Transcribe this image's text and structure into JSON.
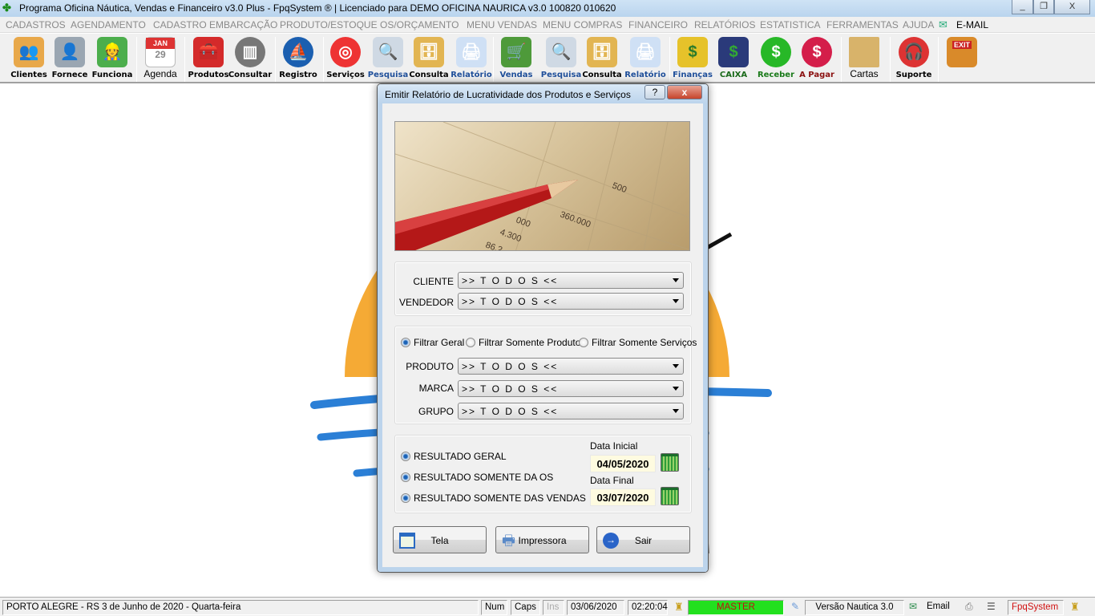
{
  "window": {
    "title": "Programa Oficina Náutica, Vendas e Financeiro v3.0 Plus - FpqSystem ® | Licenciado para  DEMO OFICINA NAURICA v3.0 100820 010620",
    "minimize": "_",
    "restore": "❐",
    "close": "X"
  },
  "menu": [
    "CADASTROS",
    "AGENDAMENTO",
    "CADASTRO EMBARCAÇÃO",
    "PRODUTO/ESTOQUE",
    "OS/ORÇAMENTO",
    "MENU VENDAS",
    "MENU COMPRAS",
    "FINANCEIRO",
    "RELATÓRIOS",
    "ESTATISTICA",
    "FERRAMENTAS",
    "AJUDA",
    "E-MAIL"
  ],
  "toolbar": [
    "Clientes",
    "Fornece",
    "Funciona",
    "Agenda",
    "Produtos",
    "Consultar",
    "Registro",
    "Serviços",
    "Pesquisa",
    "Consulta",
    "Relatório",
    "Vendas",
    "Pesquisa",
    "Consulta",
    "Relatório",
    "Finanças",
    "CAIXA",
    "Receber",
    "A Pagar",
    "Cartas",
    "Suporte"
  ],
  "toolbar_extra": {
    "agenda_month": "JAN",
    "agenda_day": "29",
    "exit_sign": "EXIT"
  },
  "dialog": {
    "title": "Emitir Relatório de Lucratividade dos Produtos e Serviços",
    "help": "?",
    "close": "x",
    "photo_numbers": [
      "500",
      "360.000",
      "000",
      "4.300",
      "86.2"
    ],
    "cliente_label": "CLIENTE",
    "cliente_value": ">> T O D O S <<",
    "vendedor_label": "VENDEDOR",
    "vendedor_value": ">> T O D O S <<",
    "filters": {
      "geral": "Filtrar Geral",
      "produtos": "Filtrar Somente Produtos",
      "servicos": "Filtrar Somente Serviços"
    },
    "produto_label": "PRODUTO",
    "produto_value": ">> T O D O S <<",
    "marca_label": "MARCA",
    "marca_value": ">> T O D O S <<",
    "grupo_label": "GRUPO",
    "grupo_value": ">> T O D O S <<",
    "results": {
      "geral": "RESULTADO GERAL",
      "os": "RESULTADO SOMENTE DA OS",
      "vendas": "RESULTADO SOMENTE DAS VENDAS"
    },
    "data_inicial_label": "Data Inicial",
    "data_inicial": "04/05/2020",
    "data_final_label": "Data Final",
    "data_final": "03/07/2020",
    "buttons": {
      "tela": "Tela",
      "impressora": "Impressora",
      "sair": "Sair"
    }
  },
  "status": {
    "location": "PORTO ALEGRE - RS  3 de Junho de 2020 - Quarta-feira",
    "num": "Num",
    "caps": "Caps",
    "ins": "Ins",
    "date": "03/06/2020",
    "time": "02:20:04",
    "user": "MASTER",
    "version": "Versão Nautica 3.0",
    "email": "Email",
    "brand": "FpqSystem"
  },
  "colors": {
    "user_badge": "#22e01e",
    "brand": "#d01010",
    "date_bg": "#fefbe0"
  }
}
